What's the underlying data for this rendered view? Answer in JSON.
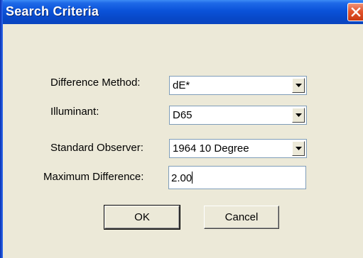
{
  "window": {
    "title": "Search Criteria",
    "close_icon": "close-icon"
  },
  "colors": {
    "titlebar": "#0a52d9",
    "dialog_bg": "#ece9d8",
    "close_button": "#e2542c"
  },
  "fields": {
    "difference_method": {
      "label": "Difference Method:",
      "value": "dE*"
    },
    "illuminant": {
      "label": "Illuminant:",
      "value": "D65"
    },
    "standard_observer": {
      "label": "Standard Observer:",
      "value": "1964 10 Degree"
    },
    "maximum_difference": {
      "label": "Maximum Difference:",
      "value": "2.00"
    }
  },
  "buttons": {
    "ok": "OK",
    "cancel": "Cancel"
  }
}
